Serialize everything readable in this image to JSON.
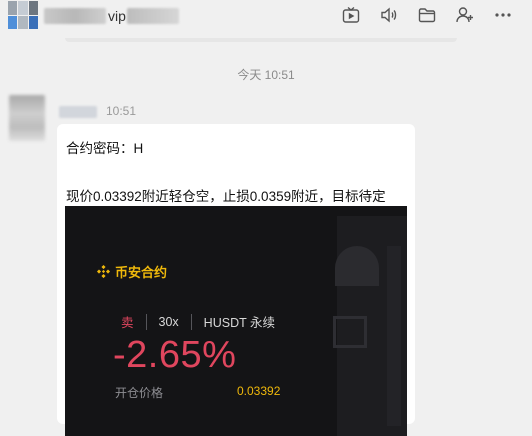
{
  "header": {
    "title_partial": "vip",
    "toolbar": [
      {
        "icon": "live-tv-icon"
      },
      {
        "icon": "speaker-icon"
      },
      {
        "icon": "folder-icon"
      },
      {
        "icon": "add-user-icon"
      },
      {
        "icon": "more-icon"
      }
    ]
  },
  "timestamp": "今天 10:51",
  "message": {
    "time": "10:51",
    "line1": "合约密码：H",
    "line2": "现价0.03392附近轻仓空，止损0.0359附近，目标待定"
  },
  "card": {
    "brand": "币安合约",
    "side": "卖",
    "leverage": "30x",
    "pair": "HUSDT 永续",
    "pnl": "-2.65%",
    "entry_label": "开仓价格",
    "entry_value": "0.03392"
  },
  "colors": {
    "background": "#f0f0f0",
    "bubble": "#ffffff",
    "card": "#141416",
    "loss_red": "#e0465e",
    "binance_yellow": "#f0b90b"
  }
}
